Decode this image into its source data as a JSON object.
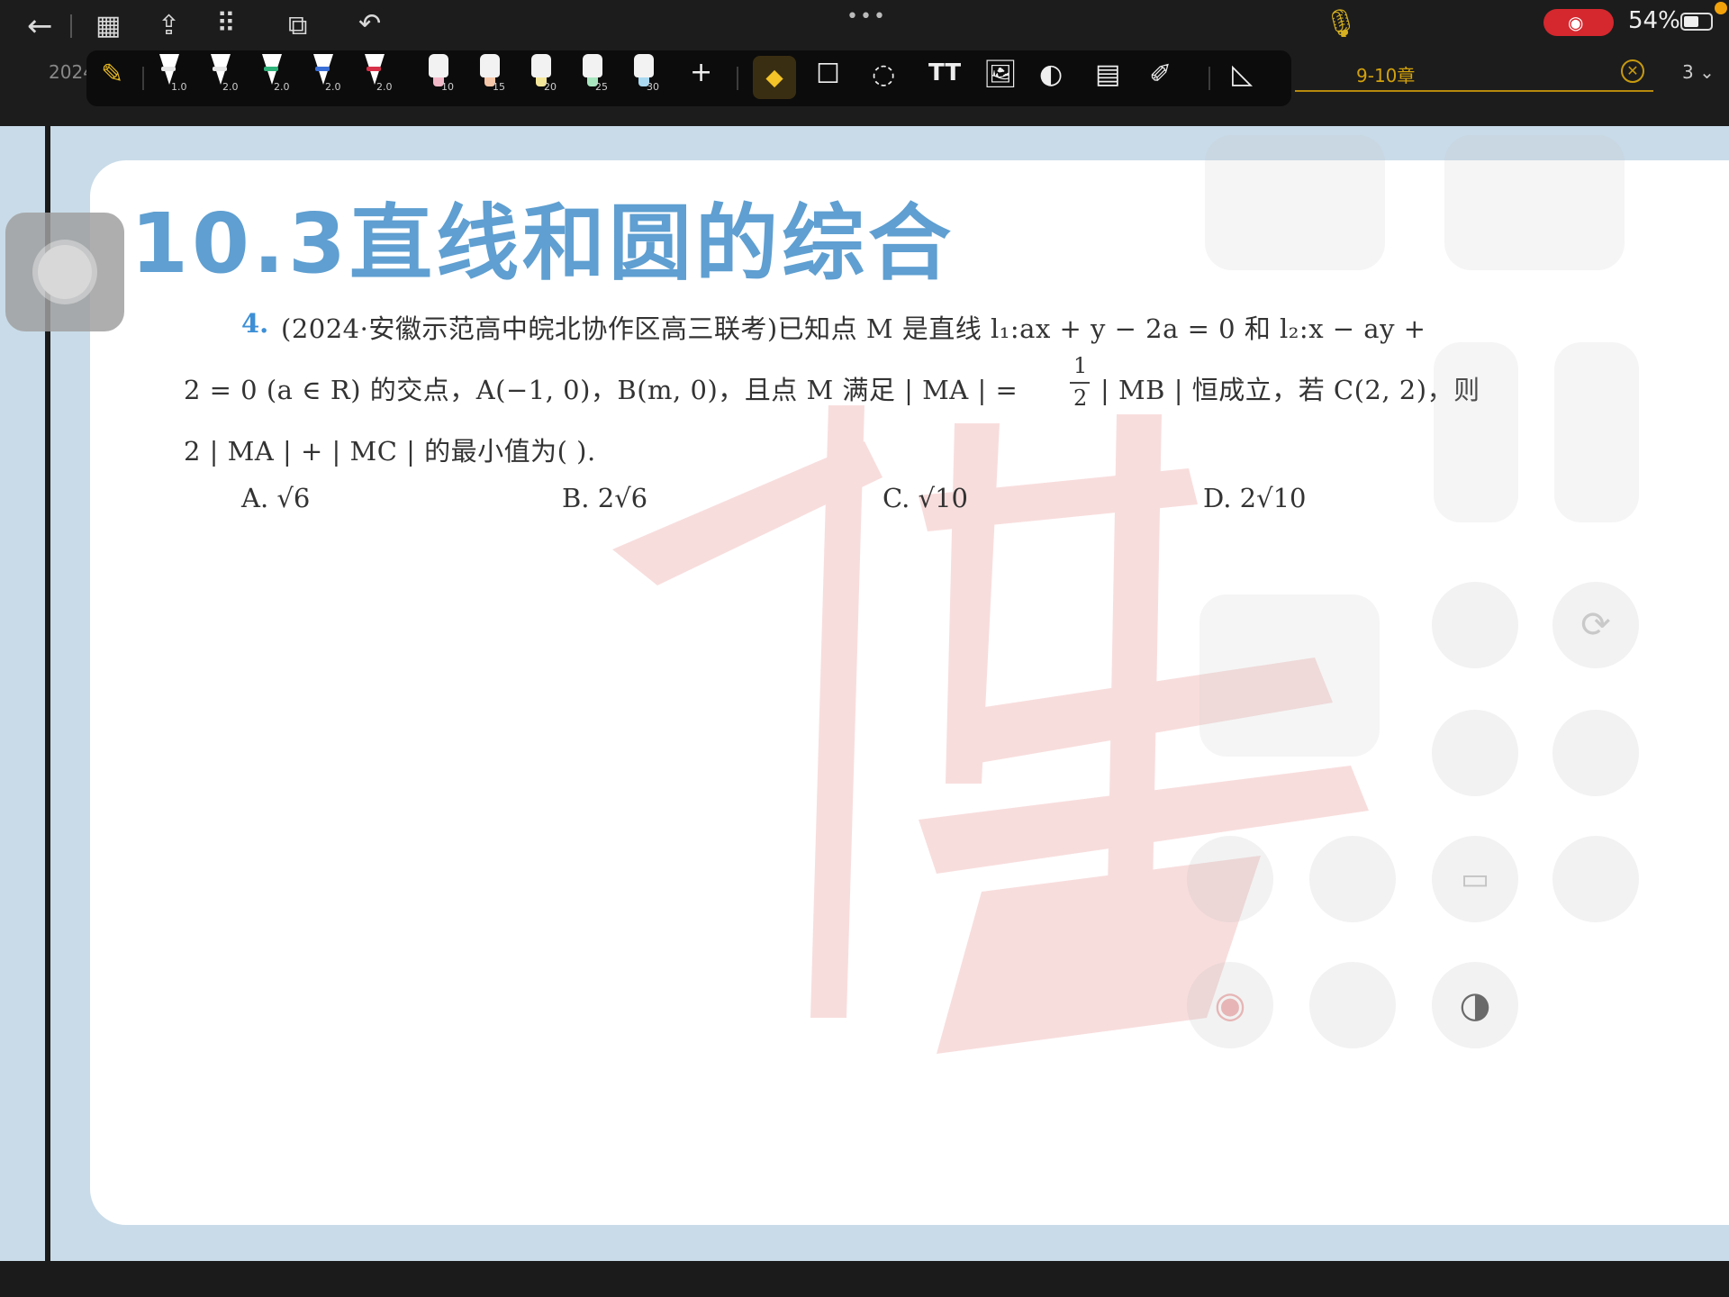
{
  "status": {
    "battery": "54%"
  },
  "tabs": {
    "left_tab": "2024",
    "chapter_tab": "9-10章",
    "page_count": "3"
  },
  "pen_toolbar": {
    "pens": [
      {
        "size": "1.0",
        "band": "#e6e6e6"
      },
      {
        "size": "2.0",
        "band": "#e6e6e6"
      },
      {
        "size": "2.0",
        "band": "#2fb37a"
      },
      {
        "size": "2.0",
        "band": "#3b6fd8"
      },
      {
        "size": "2.0",
        "band": "#d8324a"
      }
    ],
    "highlighters": [
      {
        "size": "10",
        "color": "#f3b9c8"
      },
      {
        "size": "15",
        "color": "#f6c7a8"
      },
      {
        "size": "20",
        "color": "#f5e79a"
      },
      {
        "size": "25",
        "color": "#a8e6c0"
      },
      {
        "size": "30",
        "color": "#a9d8f0"
      }
    ],
    "text_tool_label": "TT"
  },
  "document": {
    "chapter_title": "10.3直线和圆的综合",
    "question_number": "4.",
    "line1": "(2024·安徽示范高中皖北协作区高三联考)已知点 M 是直线 l₁:ax + y − 2a = 0 和 l₂:x − ay +",
    "line2a": "2 = 0 (a ∈ R) 的交点，A(−1, 0)，B(m, 0)，且点 M 满足 | MA | =",
    "frac_num": "1",
    "frac_den": "2",
    "line2b": "| MB | 恒成立，若 C(2, 2)，则",
    "line3": "2 | MA | + | MC | 的最小值为(        ).",
    "options": {
      "a": "A.  √6",
      "b": "B.  2√6",
      "c": "C.  √10",
      "d": "D.  2√10"
    }
  },
  "colors": {
    "title_blue": "#5f9fd1",
    "accent_gold": "#d2a10c",
    "record_red": "#d4282e"
  }
}
